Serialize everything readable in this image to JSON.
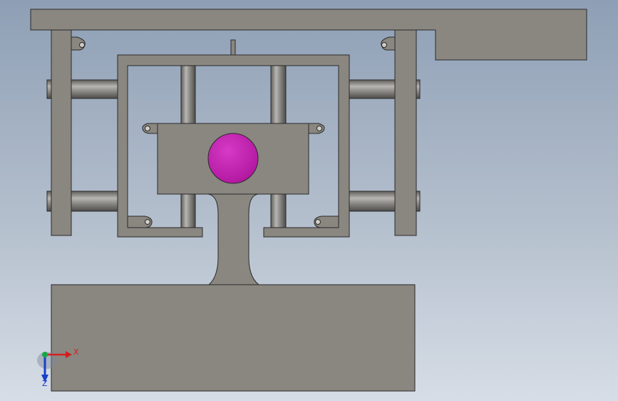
{
  "colors": {
    "part_fill": "#8a8781",
    "part_stroke": "#2a2a2a",
    "rod_dark": "#6e6c68",
    "rod_light": "#b8b6b2",
    "ball": "#b0169e",
    "ball_highlight": "#d63ac6",
    "axis_x": "#d22020",
    "axis_y": "#1aa64a",
    "axis_z": "#1a3fc8"
  },
  "triad": {
    "x_label": "X",
    "z_label": "Z"
  },
  "components": [
    "top-plate",
    "left-frame-column",
    "right-frame-column",
    "inner-frame",
    "carriage-block",
    "payload-ball",
    "support-pedestal",
    "base-block",
    "guide-rods",
    "pin-lugs"
  ]
}
